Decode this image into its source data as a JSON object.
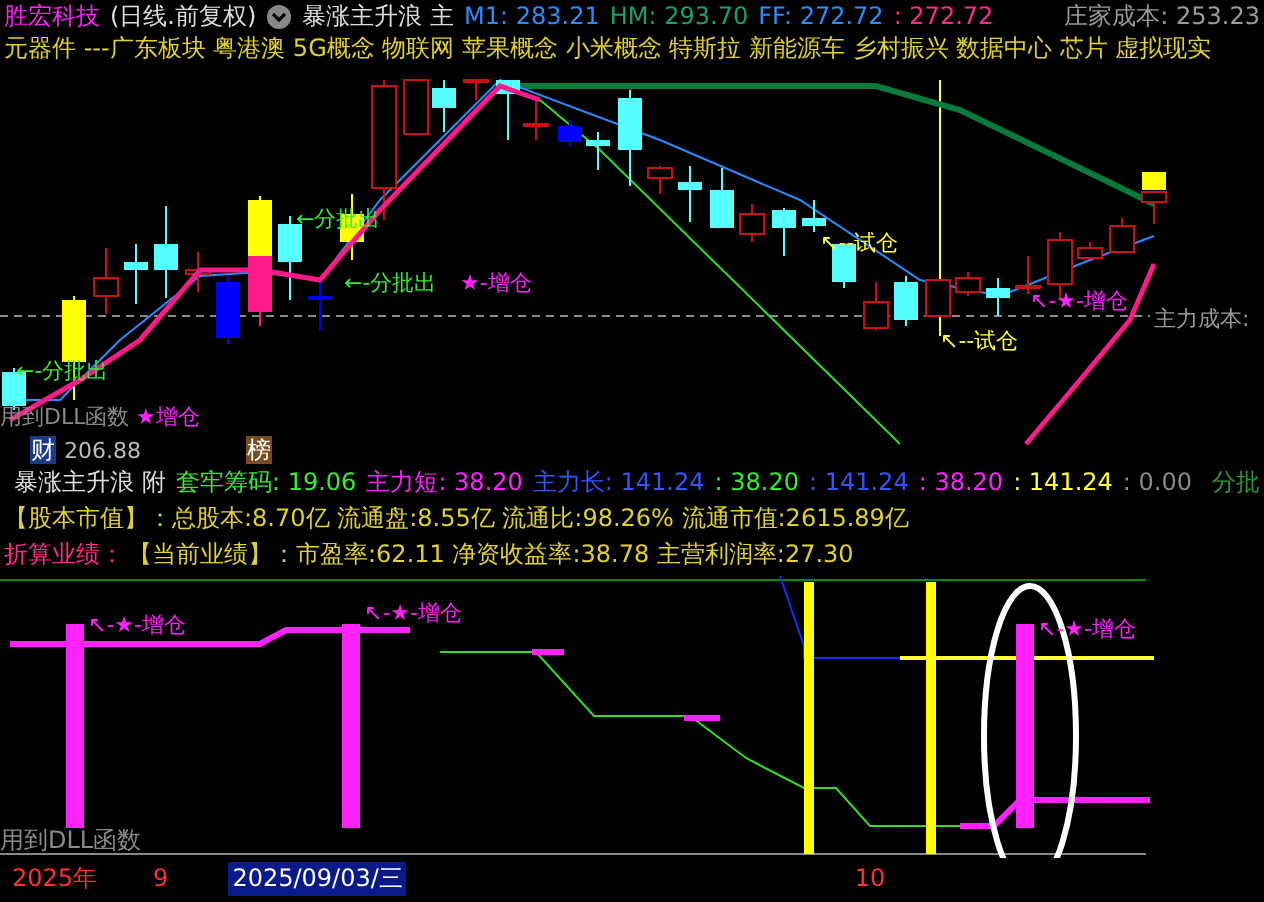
{
  "header": {
    "stock_name": "胜宏科技",
    "period": "(日线.前复权)",
    "indicator": "暴涨主升浪 主",
    "values": [
      {
        "text": "M1: 283.21",
        "color": "#2a8cff"
      },
      {
        "text": "HM: 293.70",
        "color": "#1aa06a"
      },
      {
        "text": "FF: 272.72",
        "color": "#2a8cff"
      },
      {
        "text": ": 272.72",
        "color": "#ff2a8a"
      }
    ],
    "cost": "庄家成本: 253.23"
  },
  "concepts": "元器件 ---广东板块 粤港澳 5G概念 物联网 苹果概念 小米概念 特斯拉 新能源车 乡村振兴 数据中心 芯片 虚拟现实",
  "main_chart": {
    "labels": [
      {
        "text": "←-分批出",
        "color": "#33ee33"
      },
      {
        "text": "←分批出",
        "color": "#33ee33"
      },
      {
        "text": "←-分批出",
        "color": "#33ee33"
      },
      {
        "text": "★-增仓",
        "color": "#ff22ff"
      },
      {
        "text": "↖--试仓",
        "color": "#ffff33"
      },
      {
        "text": "↖--试仓",
        "color": "#ffff33"
      },
      {
        "text": "↖-★-增仓",
        "color": "#ff22ff"
      },
      {
        "text": "主力成本:",
        "color": "#9a9a9a"
      },
      {
        "text": "用到DLL函数",
        "color": "#8a8a8a"
      },
      {
        "text": "★增仓",
        "color": "#ff22ff"
      },
      {
        "text": "206.88",
        "color": "#bbbbbb"
      }
    ],
    "badges": [
      {
        "text": "财",
        "color": "#1a3a8a"
      },
      {
        "text": "榜",
        "color": "#7a4a20"
      }
    ]
  },
  "sub_indicator": {
    "name": "暴涨主升浪 附",
    "values": [
      {
        "text": "套牢筹码: 19.06",
        "color": "#33ee33"
      },
      {
        "text": "主力短: 38.20",
        "color": "#ff22ff"
      },
      {
        "text": "主力长: 141.24",
        "color": "#3355ff"
      },
      {
        "text": ": 38.20",
        "color": "#33ee33"
      },
      {
        "text": ": 141.24",
        "color": "#3355ff"
      },
      {
        "text": ": 38.20",
        "color": "#ff22ff"
      },
      {
        "text": ": 141.24",
        "color": "#ffff33"
      },
      {
        "text": ": 0.00",
        "color": "#8a8a8a"
      }
    ],
    "right_label": "分批"
  },
  "capital_line": "【股本市值】：总股本:8.70亿 流通盘:8.55亿 流通比:98.26% 流通市值:2615.89亿",
  "earnings": {
    "label": "折算业绩：",
    "text": "【当前业绩】：市盈率:62.11 净资收益率:38.78 主营利润率:27.30"
  },
  "lower_chart": {
    "labels": [
      "↖-★-增仓",
      "↖-★-增仓",
      "↖-★-增仓"
    ],
    "note": "用到DLL函数"
  },
  "footer": {
    "year": "2025年",
    "month": "9",
    "date": "2025/09/03/三",
    "month_next": "10"
  }
}
